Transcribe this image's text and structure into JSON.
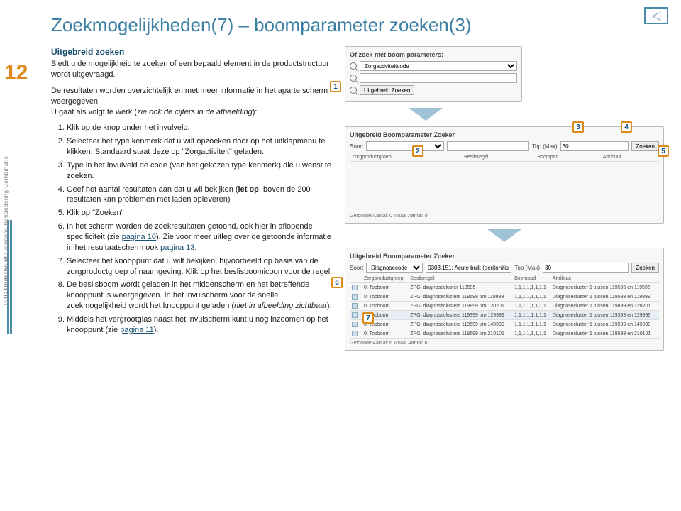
{
  "slide_number": "12",
  "title": "Zoekmogelijkheden(7) – boomparameter zoeken(3)",
  "side_brand": "DBC Onderhoud",
  "side_sub": "Diagnose Behandeling Combinatie",
  "nav_icon": "◁",
  "intro": {
    "heading": "Uitgebreid zoeken",
    "p1": "Biedt u de mogelijkheid te zoeken of een bepaald element in de productstructuur wordt uitgevraagd.",
    "p2a": "De resultaten worden overzichtelijk en met meer informatie in het aparte scherm weergegeven.",
    "p2b": "U gaat als volgt te werk (",
    "p2c": "zie ook de cijfers in de afbeelding",
    "p2d": "):"
  },
  "steps": {
    "s1": "Klik op de knop onder het invulveld.",
    "s2a": "Selecteer het type kenmerk dat u wilt opzoeken door op het uitklapmenu te klikken. Standaard staat deze op \"Zorgactiviteit\" geladen.",
    "s3": "Type in het invulveld de code (van het gekozen type kenmerk) die u wenst te zoeken.",
    "s4a": "Geef het aantal resultaten aan dat u wil bekijken (",
    "s4b": "let op",
    "s4c": ", boven de 200 resultaten kan problemen met laden opleveren)",
    "s5": "Klik op \"Zoeken\"",
    "s6a": "In het scherm worden de zoekresultaten getoond, ook hier in aflopende specificiteit (zie ",
    "s6b": "pagina 10",
    "s6c": "). Zie voor meer uitleg over de getoonde informatie in het resultaatscherm ook ",
    "s6d": "pagina 13",
    "s6e": ".",
    "s7a": "Selecteer het knooppunt dat u wilt bekijken, bijvoorbeeld op basis van de zorgproductgroep of naamgeving. Klik op het beslisboomicoon voor de regel.",
    "s8a": "De beslisboom wordt geladen in het middenscherm en het betreffende knooppunt is weergegeven. ",
    "s8b": "In het invulscherm voor de snelle zoekmogelijkheid wordt het knooppunt geladen (",
    "s8c": "niet in afbeelding zichtbaar",
    "s8d": ").",
    "s9a": "Middels het vergrootglas naast het invulscherm kunt u nog inzoomen op het knooppunt (zie ",
    "s9b": "pagina 11",
    "s9c": ")."
  },
  "shot1": {
    "title": "Of zoek met boom parameters:",
    "select_val": "Zorgactiviteitcode",
    "btn": "Uitgebreid Zoeken"
  },
  "shot2": {
    "title": "Uitgebreid Boomparameter Zoeker",
    "soort": "Soort",
    "top": "Top (Max)",
    "top_val": "30",
    "zoek": "Zoeken",
    "hdr1": "Zorgproductgroep",
    "hdr2": "Beslisregel",
    "hdr3": "Boompad",
    "hdr4": "Attribuut",
    "footer": "Getoonde Aantal: 0 Totaal Aantal: 0"
  },
  "shot3": {
    "title": "Uitgebreid Boomparameter Zoeker",
    "soort": "Soort",
    "soort_val": "Diagnosecode",
    "code": "0303.151: Acute buik (peritonitis)",
    "top": "Top (Max)",
    "top_val": "30",
    "zoek": "Zoeken",
    "hdr1": "Zorgproductgroep",
    "hdr2": "Beslisregel",
    "hdr3": "Boompad",
    "hdr4": "Attribuut",
    "rows": [
      {
        "g": "0: Topboom",
        "r": "ZPG: diagnosecluster 119595",
        "p": "1,1,1,1,1,1,1,1",
        "a": "Diagnosecluster 1 tussen 119595 en 119595"
      },
      {
        "g": "0: Topboom",
        "r": "ZPG: diagnoseclusters 119599 t/m 119899",
        "p": "1,1,1,1,1,1,1,1",
        "a": "Diagnosecluster 1 tussen 119599 en 119899"
      },
      {
        "g": "0: Topboom",
        "r": "ZPG: diagnoseclusters 119899 t/m 120201",
        "p": "1,1,1,1,1,1,1,1",
        "a": "Diagnosecluster 1 tussen 119899 en 120201"
      },
      {
        "g": "0: Topboom",
        "r": "ZPG: diagnoseclusters 119399 t/m 129999",
        "p": "1,1,1,1,1,1,1,1",
        "a": "Diagnosecluster 1 tussen 119399 en 129999"
      },
      {
        "g": "0: Topboom",
        "r": "ZPG: diagnoseclusters 119599 t/m 149999",
        "p": "1,1,1,1,1,1,1,1",
        "a": "Diagnosecluster 1 tussen 119599 en 149999"
      },
      {
        "g": "0: Topboom",
        "r": "ZPG: diagnoseclusters 119599 t/m 210101",
        "p": "1,1,1,1,1,1,1,1",
        "a": "Diagnosecluster 1 tussen 119599 en 210101"
      }
    ],
    "footer": "Getoonde Aantal: 6 Totaal Aantal: 6"
  },
  "callouts": {
    "c1": "1",
    "c2": "2",
    "c3": "3",
    "c4": "4",
    "c5": "5",
    "c6": "6",
    "c7": "7"
  }
}
